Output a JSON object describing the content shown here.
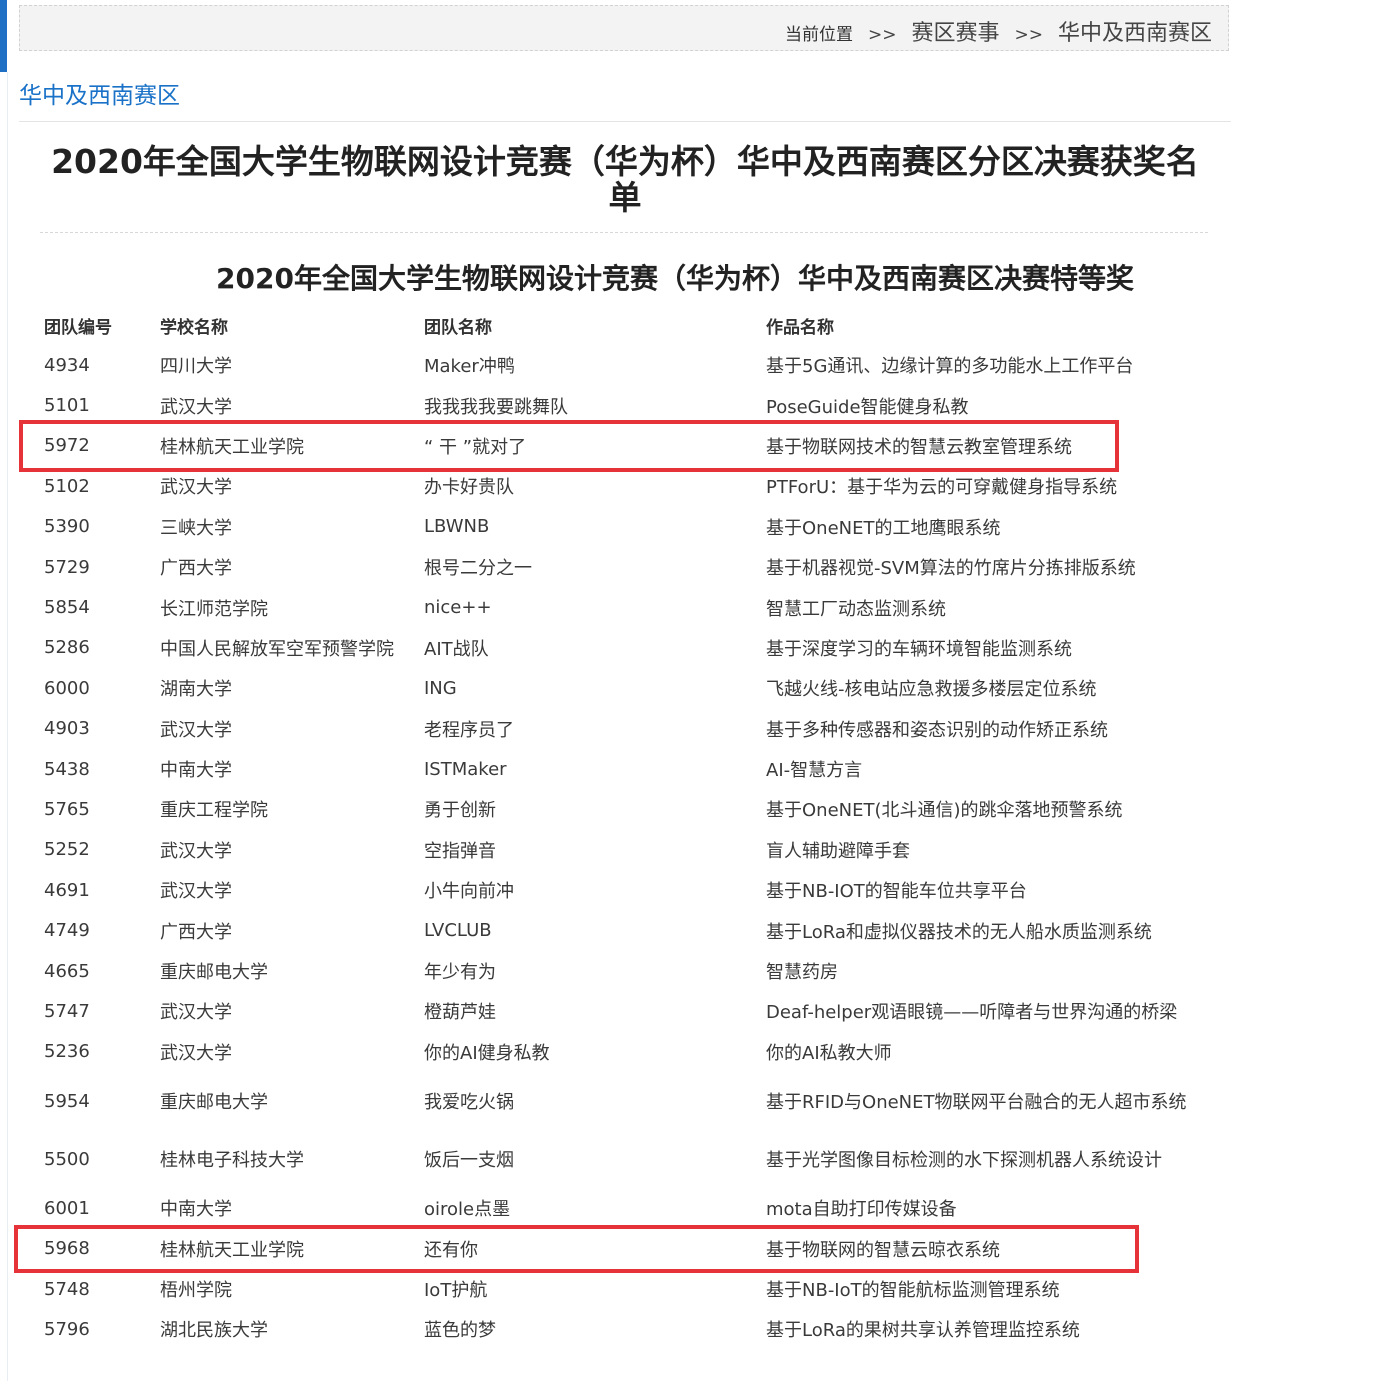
{
  "breadcrumb": {
    "prefix": "当前位置",
    "separator": ">>",
    "items": [
      "赛区赛事",
      "华中及西南赛区"
    ]
  },
  "section_heading": "华中及西南赛区",
  "article_title": "2020年全国大学生物联网设计竞赛（华为杯）华中及西南赛区分区决赛获奖名单",
  "award_title": "2020年全国大学生物联网设计竞赛（华为杯）华中及西南赛区决赛特等奖",
  "table": {
    "headers": [
      "团队编号",
      "学校名称",
      "团队名称",
      "作品名称"
    ],
    "rows": [
      [
        "4934",
        "四川大学",
        "Maker冲鸭",
        "基于5G通讯、边缘计算的多功能水上工作平台"
      ],
      [
        "5101",
        "武汉大学",
        "我我我我要跳舞队",
        "PoseGuide智能健身私教"
      ],
      [
        "5972",
        "桂林航天工业学院",
        "“ 干 ”就对了",
        "基于物联网技术的智慧云教室管理系统"
      ],
      [
        "5102",
        "武汉大学",
        "办卡好贵队",
        "PTForU：基于华为云的可穿戴健身指导系统"
      ],
      [
        "5390",
        "三峡大学",
        "LBWNB",
        "基于OneNET的工地鹰眼系统"
      ],
      [
        "5729",
        "广西大学",
        "根号二分之一",
        "基于机器视觉-SVM算法的竹席片分拣排版系统"
      ],
      [
        "5854",
        "长江师范学院",
        "nice++",
        "智慧工厂动态监测系统"
      ],
      [
        "5286",
        "中国人民解放军空军预警学院",
        "AIT战队",
        "基于深度学习的车辆环境智能监测系统"
      ],
      [
        "6000",
        "湖南大学",
        "ING",
        "飞越火线-核电站应急救援多楼层定位系统"
      ],
      [
        "4903",
        "武汉大学",
        "老程序员了",
        "基于多种传感器和姿态识别的动作矫正系统"
      ],
      [
        "5438",
        "中南大学",
        "ISTMaker",
        "AI-智慧方言"
      ],
      [
        "5765",
        "重庆工程学院",
        "勇于创新",
        "基于OneNET(北斗通信)的跳伞落地预警系统"
      ],
      [
        "5252",
        "武汉大学",
        "空指弹音",
        "盲人辅助避障手套"
      ],
      [
        "4691",
        "武汉大学",
        "小牛向前冲",
        "基于NB-IOT的智能车位共享平台"
      ],
      [
        "4749",
        "广西大学",
        "LVCLUB",
        "基于LoRa和虚拟仪器技术的无人船水质监测系统"
      ],
      [
        "4665",
        "重庆邮电大学",
        "年少有为",
        "智慧药房"
      ],
      [
        "5747",
        "武汉大学",
        "橙葫芦娃",
        "Deaf-helper观语眼镜——听障者与世界沟通的桥梁"
      ],
      [
        "5236",
        "武汉大学",
        "你的AI健身私教",
        "你的AI私教大师"
      ],
      [
        "5954",
        "重庆邮电大学",
        "我爱吃火锅",
        "基于RFID与OneNET物联网平台融合的无人超市系统"
      ],
      [
        "5500",
        "桂林电子科技大学",
        "饭后一支烟",
        "基于光学图像目标检测的水下探测机器人系统设计"
      ],
      [
        "6001",
        "中南大学",
        "oirole点墨",
        "mota自助打印传媒设备"
      ],
      [
        "5968",
        "桂林航天工业学院",
        "还有你",
        "基于物联网的智慧云晾衣系统"
      ],
      [
        "5748",
        "梧州学院",
        "IoT护航",
        "基于NB-IoT的智能航标监测管理系统"
      ],
      [
        "5796",
        "湖北民族大学",
        "蓝色的梦",
        "基于LoRa的果树共享认养管理监控系统"
      ]
    ],
    "tall_rows": [
      18,
      19
    ],
    "highlighted_rows": [
      2,
      21
    ]
  },
  "colors": {
    "accent": "#1f6fc4",
    "heading_link": "#1a72c8",
    "highlight": "#e63339"
  }
}
